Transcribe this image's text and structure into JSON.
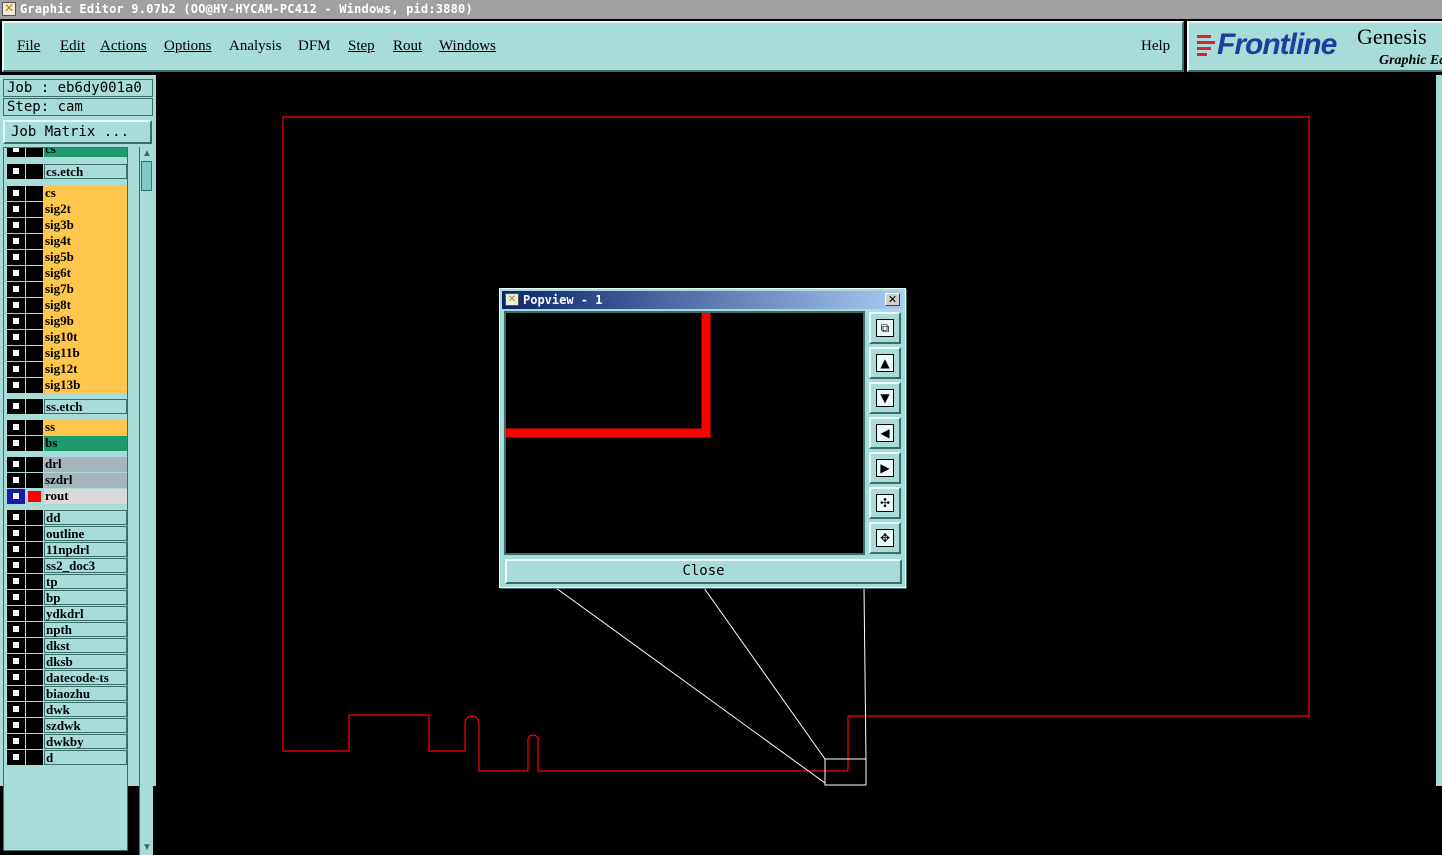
{
  "window": {
    "title": "Graphic Editor 9.07b2 (OO@HY-HYCAM-PC412 - Windows, pid:3880)"
  },
  "menu": {
    "items": [
      "File",
      "Edit",
      "Actions",
      "Options",
      "Analysis",
      "DFM",
      "Step",
      "Rout",
      "Windows"
    ],
    "help": "Help"
  },
  "logo": {
    "brand": "Frontline",
    "product": "Genesis",
    "subtitle": "Graphic Editor"
  },
  "job": {
    "job_label": "Job : eb6dy001a0",
    "step_label": "Step: cam",
    "matrix_button": "Job Matrix ..."
  },
  "layers": [
    {
      "name": "cs",
      "style": "green",
      "checked": false
    },
    {
      "name": "cs.etch",
      "style": "teal",
      "checked": false
    },
    {
      "name": "cs",
      "style": "orange",
      "checked": false
    },
    {
      "name": "sig2t",
      "style": "orange",
      "checked": false
    },
    {
      "name": "sig3b",
      "style": "orange",
      "checked": false
    },
    {
      "name": "sig4t",
      "style": "orange",
      "checked": false
    },
    {
      "name": "sig5b",
      "style": "orange",
      "checked": false
    },
    {
      "name": "sig6t",
      "style": "orange",
      "checked": false
    },
    {
      "name": "sig7b",
      "style": "orange",
      "checked": false
    },
    {
      "name": "sig8t",
      "style": "orange",
      "checked": false
    },
    {
      "name": "sig9b",
      "style": "orange",
      "checked": false
    },
    {
      "name": "sig10t",
      "style": "orange",
      "checked": false
    },
    {
      "name": "sig11b",
      "style": "orange",
      "checked": false
    },
    {
      "name": "sig12t",
      "style": "orange",
      "checked": false
    },
    {
      "name": "sig13b",
      "style": "orange",
      "checked": false
    },
    {
      "name": "ss.etch",
      "style": "teal",
      "checked": false
    },
    {
      "name": "ss",
      "style": "orange",
      "checked": false
    },
    {
      "name": "bs",
      "style": "green",
      "checked": false
    },
    {
      "name": "drl",
      "style": "gray",
      "checked": false
    },
    {
      "name": "szdrl",
      "style": "gray",
      "checked": false
    },
    {
      "name": "rout",
      "style": "light",
      "checked": true,
      "color": "#ff0000"
    },
    {
      "name": "dd",
      "style": "teal",
      "checked": false
    },
    {
      "name": "outline",
      "style": "teal",
      "checked": false
    },
    {
      "name": "11npdrl",
      "style": "teal",
      "checked": false
    },
    {
      "name": "ss2_doc3",
      "style": "teal",
      "checked": false
    },
    {
      "name": "tp",
      "style": "teal",
      "checked": false
    },
    {
      "name": "bp",
      "style": "teal",
      "checked": false
    },
    {
      "name": "ydkdrl",
      "style": "teal",
      "checked": false
    },
    {
      "name": "npth",
      "style": "teal",
      "checked": false
    },
    {
      "name": "dkst",
      "style": "teal",
      "checked": false
    },
    {
      "name": "dksb",
      "style": "teal",
      "checked": false
    },
    {
      "name": "datecode-ts",
      "style": "teal",
      "checked": false
    },
    {
      "name": "biaozhu",
      "style": "teal",
      "checked": false
    },
    {
      "name": "dwk",
      "style": "teal",
      "checked": false
    },
    {
      "name": "szdwk",
      "style": "teal",
      "checked": false
    },
    {
      "name": "dwkby",
      "style": "teal",
      "checked": false
    },
    {
      "name": "d",
      "style": "teal",
      "checked": false
    }
  ],
  "popview": {
    "title": "Popview - 1",
    "close_label": "Close",
    "tool_icons": [
      "fit-window-icon",
      "pan-up-icon",
      "pan-down-icon",
      "pan-left-icon",
      "pan-right-icon",
      "zoom-out-icon",
      "zoom-in-icon"
    ]
  },
  "colors": {
    "panel": "#a7dcd9",
    "outline": "#ff0000",
    "layer_orange": "#ffc64d",
    "layer_green": "#1f9a6d",
    "layer_gray": "#a6b4bc"
  }
}
